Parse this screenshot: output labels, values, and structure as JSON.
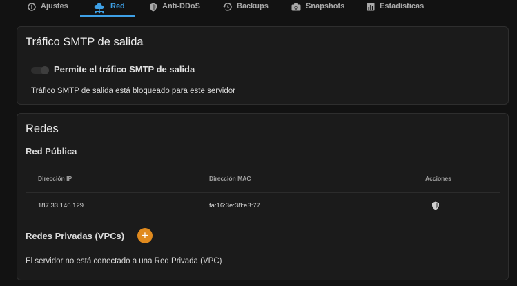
{
  "tabs": [
    {
      "label": "Ajustes",
      "icon": "info-icon"
    },
    {
      "label": "Red",
      "icon": "cloud-network-icon",
      "active": true
    },
    {
      "label": "Anti-DDoS",
      "icon": "shield-icon"
    },
    {
      "label": "Backups",
      "icon": "history-icon"
    },
    {
      "label": "Snapshots",
      "icon": "camera-icon"
    },
    {
      "label": "Estadísticas",
      "icon": "bar-chart-icon"
    }
  ],
  "smtp": {
    "title": "Tráfico SMTP de salida",
    "toggle_label": "Permite el tráfico SMTP de salida",
    "toggle_on": false,
    "status": "Tráfico SMTP de salida está bloqueado para este servidor"
  },
  "redes": {
    "title": "Redes",
    "public": {
      "title": "Red Pública",
      "columns": [
        "Dirección IP",
        "Dirección MAC",
        "Acciones"
      ],
      "rows": [
        {
          "ip": "187.33.146.129",
          "mac": "fa:16:3e:38:e3:77",
          "action_icon": "shield-icon"
        }
      ]
    },
    "private": {
      "title": "Redes Privadas (VPCs)",
      "add_label": "+",
      "empty_message": "El servidor no está conectado a una Red Privada (VPC)"
    }
  },
  "colors": {
    "accent": "#3ea0e6",
    "add_button": "#e08a1e",
    "card_bg": "#1b1b1b",
    "page_bg": "#121212"
  }
}
